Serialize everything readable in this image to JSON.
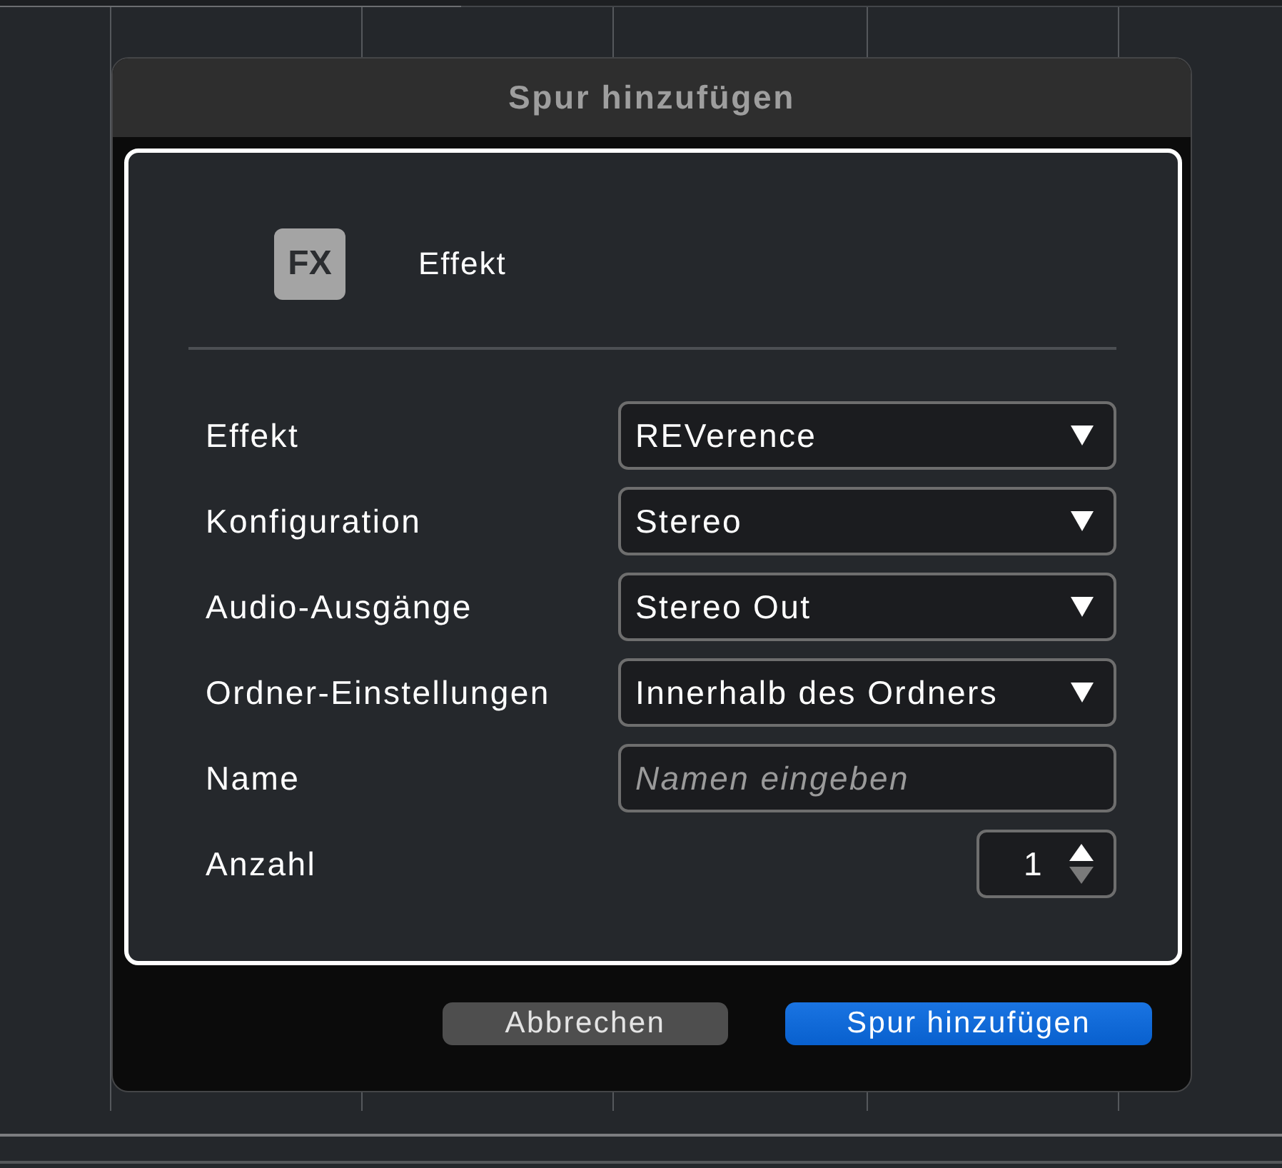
{
  "window": {
    "title": "Spur hinzufügen"
  },
  "track_type": {
    "icon_text": "FX",
    "label": "Effekt"
  },
  "fields": [
    {
      "kind": "dropdown",
      "label": "Effekt",
      "value": "REVerence"
    },
    {
      "kind": "dropdown",
      "label": "Konfiguration",
      "value": "Stereo"
    },
    {
      "kind": "dropdown",
      "label": "Audio-Ausgänge",
      "value": "Stereo Out"
    },
    {
      "kind": "dropdown",
      "label": "Ordner-Einstellungen",
      "value": "Innerhalb des Ordners"
    },
    {
      "kind": "text",
      "label": "Name",
      "placeholder": "Namen eingeben"
    },
    {
      "kind": "stepper",
      "label": "Anzahl",
      "value": "1",
      "increment_disabled": false,
      "decrement_disabled": true
    }
  ],
  "buttons": [
    {
      "kind": "secondary",
      "label": "Abbrechen"
    },
    {
      "kind": "primary",
      "label": "Spur hinzufügen"
    }
  ]
}
